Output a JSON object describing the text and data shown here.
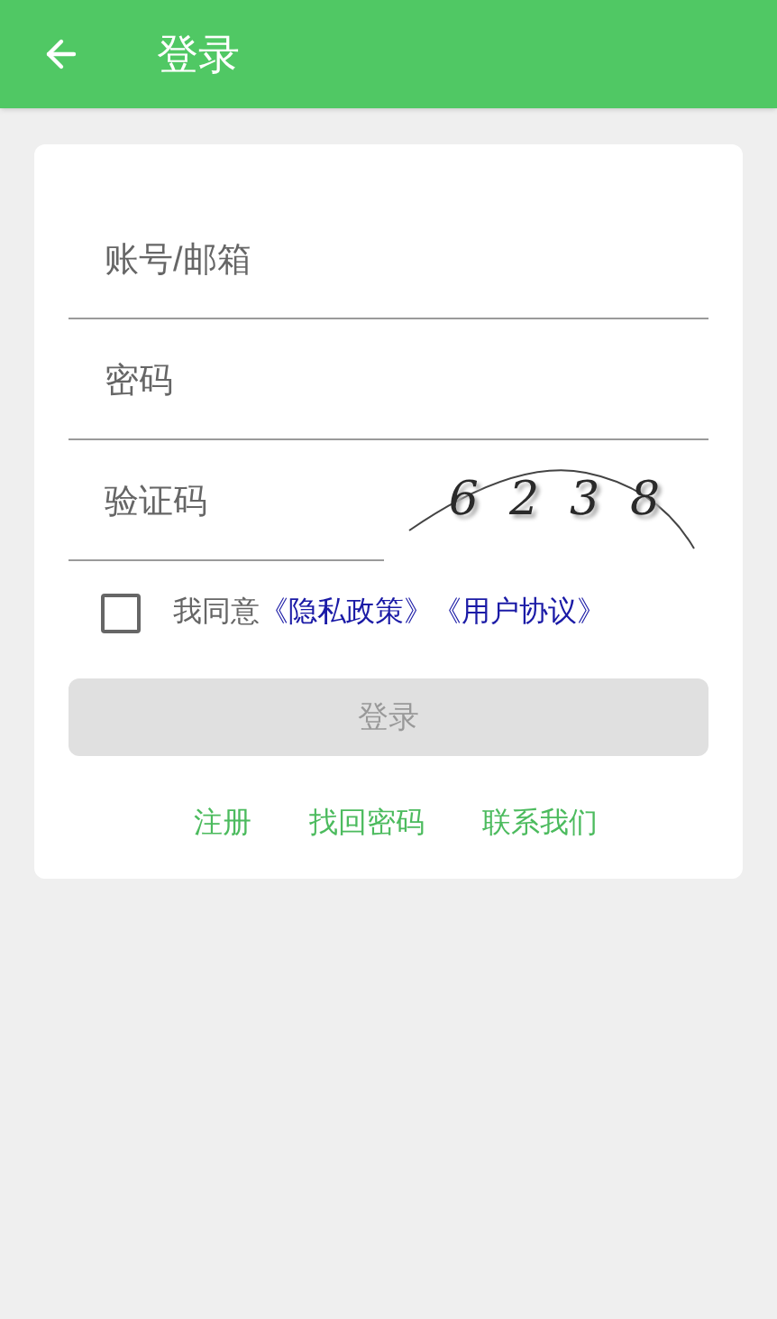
{
  "app_bar": {
    "title": "登录"
  },
  "fields": [
    {
      "placeholder": "账号/邮箱"
    },
    {
      "placeholder": "密码"
    },
    {
      "placeholder": "验证码"
    }
  ],
  "captcha": [
    "6",
    "2",
    "3",
    "8"
  ],
  "agreement": {
    "checked": false,
    "text": "我同意",
    "links": [
      "《隐私政策》",
      "《用户协议》"
    ]
  },
  "login_button": {
    "label": "登录",
    "disabled": true
  },
  "footer_links": [
    "注册",
    "找回密码",
    "联系我们"
  ]
}
